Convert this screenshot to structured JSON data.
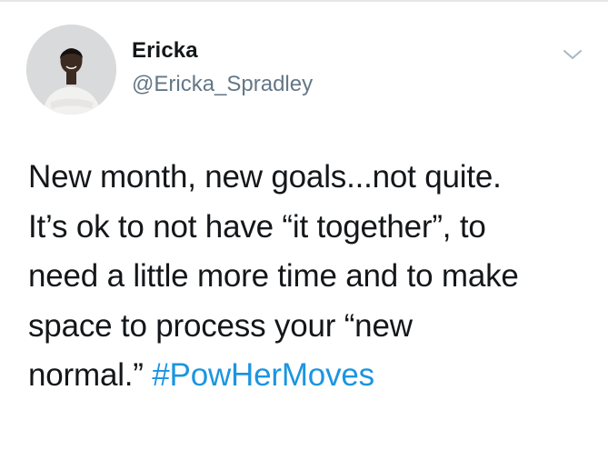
{
  "tweet": {
    "author": {
      "name": "Ericka",
      "handle": "@Ericka_Spradley"
    },
    "text_lines": [
      "New month, new goals...not quite.",
      "It’s ok to not have “it together”, to",
      "need a little more time and to make",
      "space to process your “new",
      "normal.”"
    ],
    "hashtag": "#PowHerMoves",
    "icons": {
      "menu": "chevron-down-icon",
      "avatar": "profile-photo"
    }
  },
  "colors": {
    "text": "#14171a",
    "secondary": "#657786",
    "link": "#1b95e0",
    "divider": "#e6e6e6"
  }
}
